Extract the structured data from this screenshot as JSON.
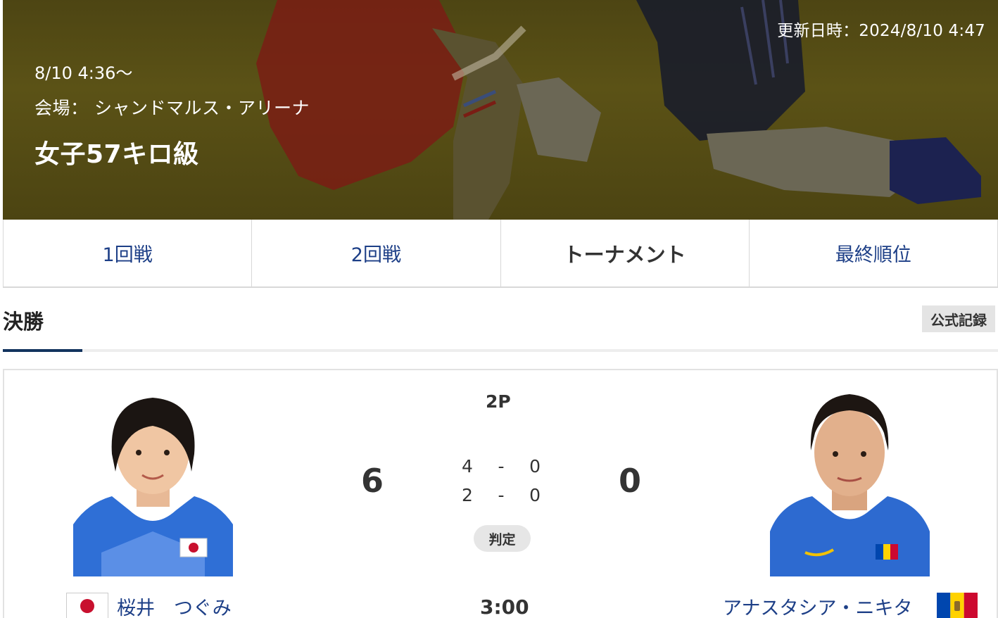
{
  "hero": {
    "updated": "更新日時：2024/8/10 4:47",
    "start_time": "8/10 4:36〜",
    "venue": "会場： シャンドマルス・アリーナ",
    "event_title": "女子57キロ級"
  },
  "tabs": [
    {
      "label": "1回戦",
      "active": false
    },
    {
      "label": "2回戦",
      "active": false
    },
    {
      "label": "トーナメント",
      "active": true
    },
    {
      "label": "最終順位",
      "active": false
    }
  ],
  "section": {
    "title": "決勝",
    "official_record": "公式記録"
  },
  "match": {
    "period": "2P",
    "score_left": "6",
    "score_right": "0",
    "periods": [
      {
        "left": "4",
        "sep": "-",
        "right": "0"
      },
      {
        "left": "2",
        "sep": "-",
        "right": "0"
      }
    ],
    "decision": "判定",
    "time": "3:00",
    "left_athlete": {
      "name": "桜井　つぐみ",
      "flag": "japan-flag"
    },
    "right_athlete": {
      "name": "アナスタシア・ニキタ",
      "flag": "moldova-flag"
    }
  },
  "colors": {
    "link_blue": "#1d3f87",
    "section_underline": "#12335e",
    "hero_tint": "#4d4513"
  }
}
